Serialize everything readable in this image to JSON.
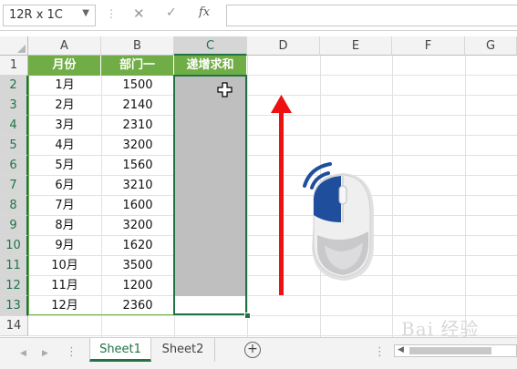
{
  "formula_bar": {
    "name_box": "12R x 1C",
    "dropdown_icon": "chevron-down-icon",
    "separator_dots": "⋮",
    "cancel_glyph": "✕",
    "enter_glyph": "✓",
    "fx_label": "fx",
    "formula_value": ""
  },
  "columns": [
    "A",
    "B",
    "C",
    "D",
    "E",
    "F",
    "G"
  ],
  "rows": [
    "1",
    "2",
    "3",
    "4",
    "5",
    "6",
    "7",
    "8",
    "9",
    "10",
    "11",
    "12",
    "13",
    "14"
  ],
  "table": {
    "headers": [
      "月份",
      "部门一",
      "递增求和"
    ],
    "rows": [
      [
        "1月",
        "1500",
        ""
      ],
      [
        "2月",
        "2140",
        ""
      ],
      [
        "3月",
        "2310",
        ""
      ],
      [
        "4月",
        "3200",
        ""
      ],
      [
        "5月",
        "1560",
        ""
      ],
      [
        "6月",
        "3210",
        ""
      ],
      [
        "7月",
        "1600",
        ""
      ],
      [
        "8月",
        "3200",
        ""
      ],
      [
        "9月",
        "1620",
        ""
      ],
      [
        "10月",
        "3500",
        ""
      ],
      [
        "11月",
        "1200",
        ""
      ],
      [
        "12月",
        "2360",
        ""
      ]
    ]
  },
  "sheet_tabs": [
    {
      "label": "Sheet1",
      "active": true
    },
    {
      "label": "Sheet2",
      "active": false
    }
  ],
  "tabbar": {
    "add_sheet": "+",
    "dots": "⋮"
  },
  "watermark": "Bai 经验",
  "colors": {
    "header_green": "#70ad47",
    "excel_green": "#217346",
    "selection_fill": "#bfbfbf",
    "arrow_red": "#ee1111",
    "mouse_blue": "#1f4e9c"
  }
}
